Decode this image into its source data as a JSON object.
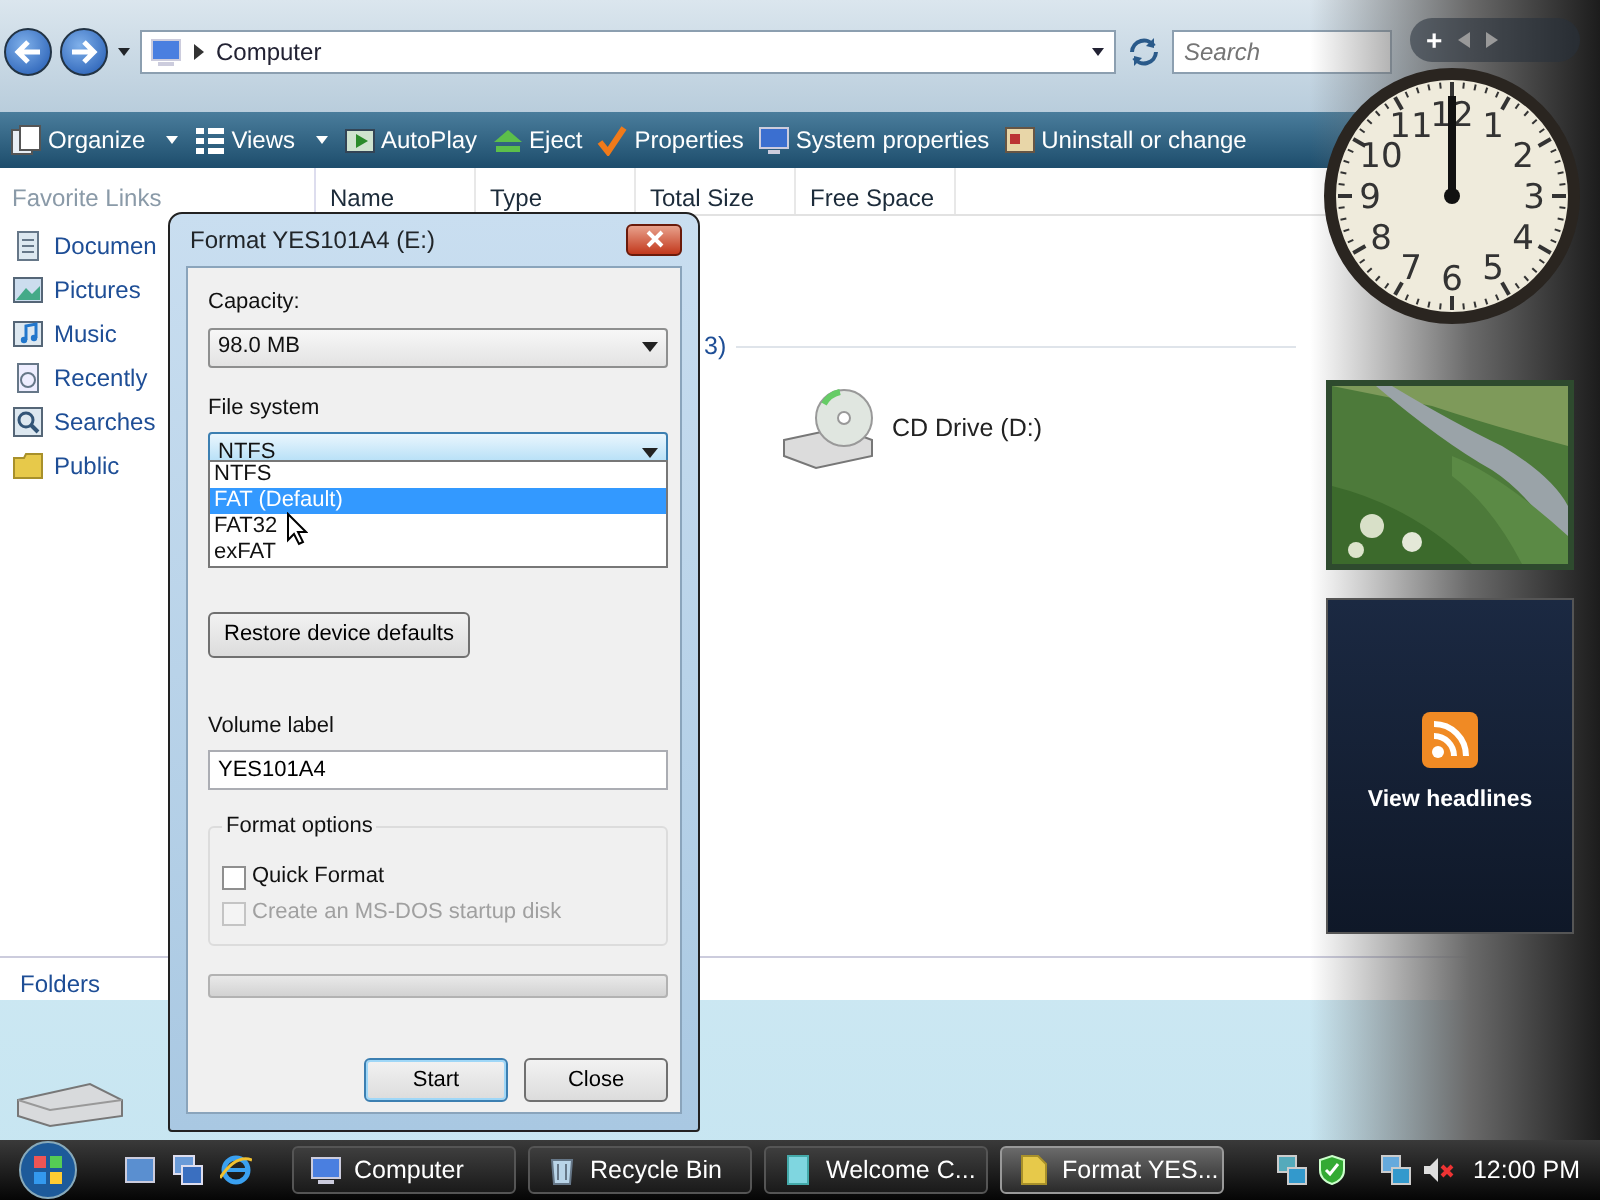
{
  "explorer": {
    "address": "Computer",
    "search": {
      "placeholder": "Search"
    },
    "toolbar": [
      {
        "label": "Organize",
        "kind": "organize",
        "menu": true
      },
      {
        "label": "Views",
        "kind": "views",
        "menu": true
      },
      {
        "label": "AutoPlay",
        "kind": "autoplay",
        "menu": false
      },
      {
        "label": "Eject",
        "kind": "eject",
        "menu": false
      },
      {
        "label": "Properties",
        "kind": "properties",
        "menu": false
      },
      {
        "label": "System properties",
        "kind": "system",
        "menu": false
      },
      {
        "label": "Uninstall or change",
        "kind": "uninstall",
        "menu": false
      }
    ],
    "favorites_title": "Favorite Links",
    "favorites": [
      {
        "label": "Documen",
        "kind": "documents"
      },
      {
        "label": "Pictures",
        "kind": "pictures"
      },
      {
        "label": "Music",
        "kind": "music"
      },
      {
        "label": "Recently",
        "kind": "recent"
      },
      {
        "label": "Searches",
        "kind": "searches"
      },
      {
        "label": "Public",
        "kind": "public"
      }
    ],
    "columns": [
      "Name",
      "Type",
      "Total Size",
      "Free Space"
    ],
    "group_header": "3)",
    "drives": [
      {
        "label": "CD Drive (D:)",
        "kind": "cd"
      }
    ],
    "folders_label": "Folders"
  },
  "dialog": {
    "title": "Format YES101A4 (E:)",
    "capacity_label": "Capacity:",
    "capacity": "98.0 MB",
    "file_system_label": "File system",
    "file_system": "NTFS",
    "file_system_options": [
      {
        "label": "NTFS",
        "selected": false
      },
      {
        "label": "FAT (Default)",
        "selected": true
      },
      {
        "label": "FAT32",
        "selected": false
      },
      {
        "label": "exFAT",
        "selected": false
      }
    ],
    "restore_button": "Restore device defaults",
    "volume_label_caption": "Volume label",
    "volume_label": "YES101A4",
    "options_title": "Format options",
    "options": [
      {
        "label": "Quick Format",
        "checked": false,
        "disabled": false
      },
      {
        "label": "Create an MS-DOS startup disk",
        "checked": false,
        "disabled": true
      }
    ],
    "progress": {
      "level": 0
    },
    "buttons": [
      {
        "label": "Start",
        "default": true
      },
      {
        "label": "Close",
        "default": false
      }
    ]
  },
  "sidebar": {
    "add_button": "+",
    "clock": {
      "numerals": [
        "12",
        "11",
        "1",
        "10",
        "2",
        "9",
        "3",
        "8",
        "4",
        "7",
        "6",
        "5"
      ]
    },
    "feed": {
      "label": "View headlines"
    }
  },
  "taskbar": {
    "tasks": [
      {
        "label": "Computer",
        "kind": "computer",
        "selected": false
      },
      {
        "label": "Recycle Bin",
        "kind": "recycle",
        "selected": false
      },
      {
        "label": "Welcome C...",
        "kind": "welcome",
        "selected": false
      },
      {
        "label": "Format YES...",
        "kind": "format",
        "selected": true
      }
    ],
    "time": "12:00 PM"
  }
}
